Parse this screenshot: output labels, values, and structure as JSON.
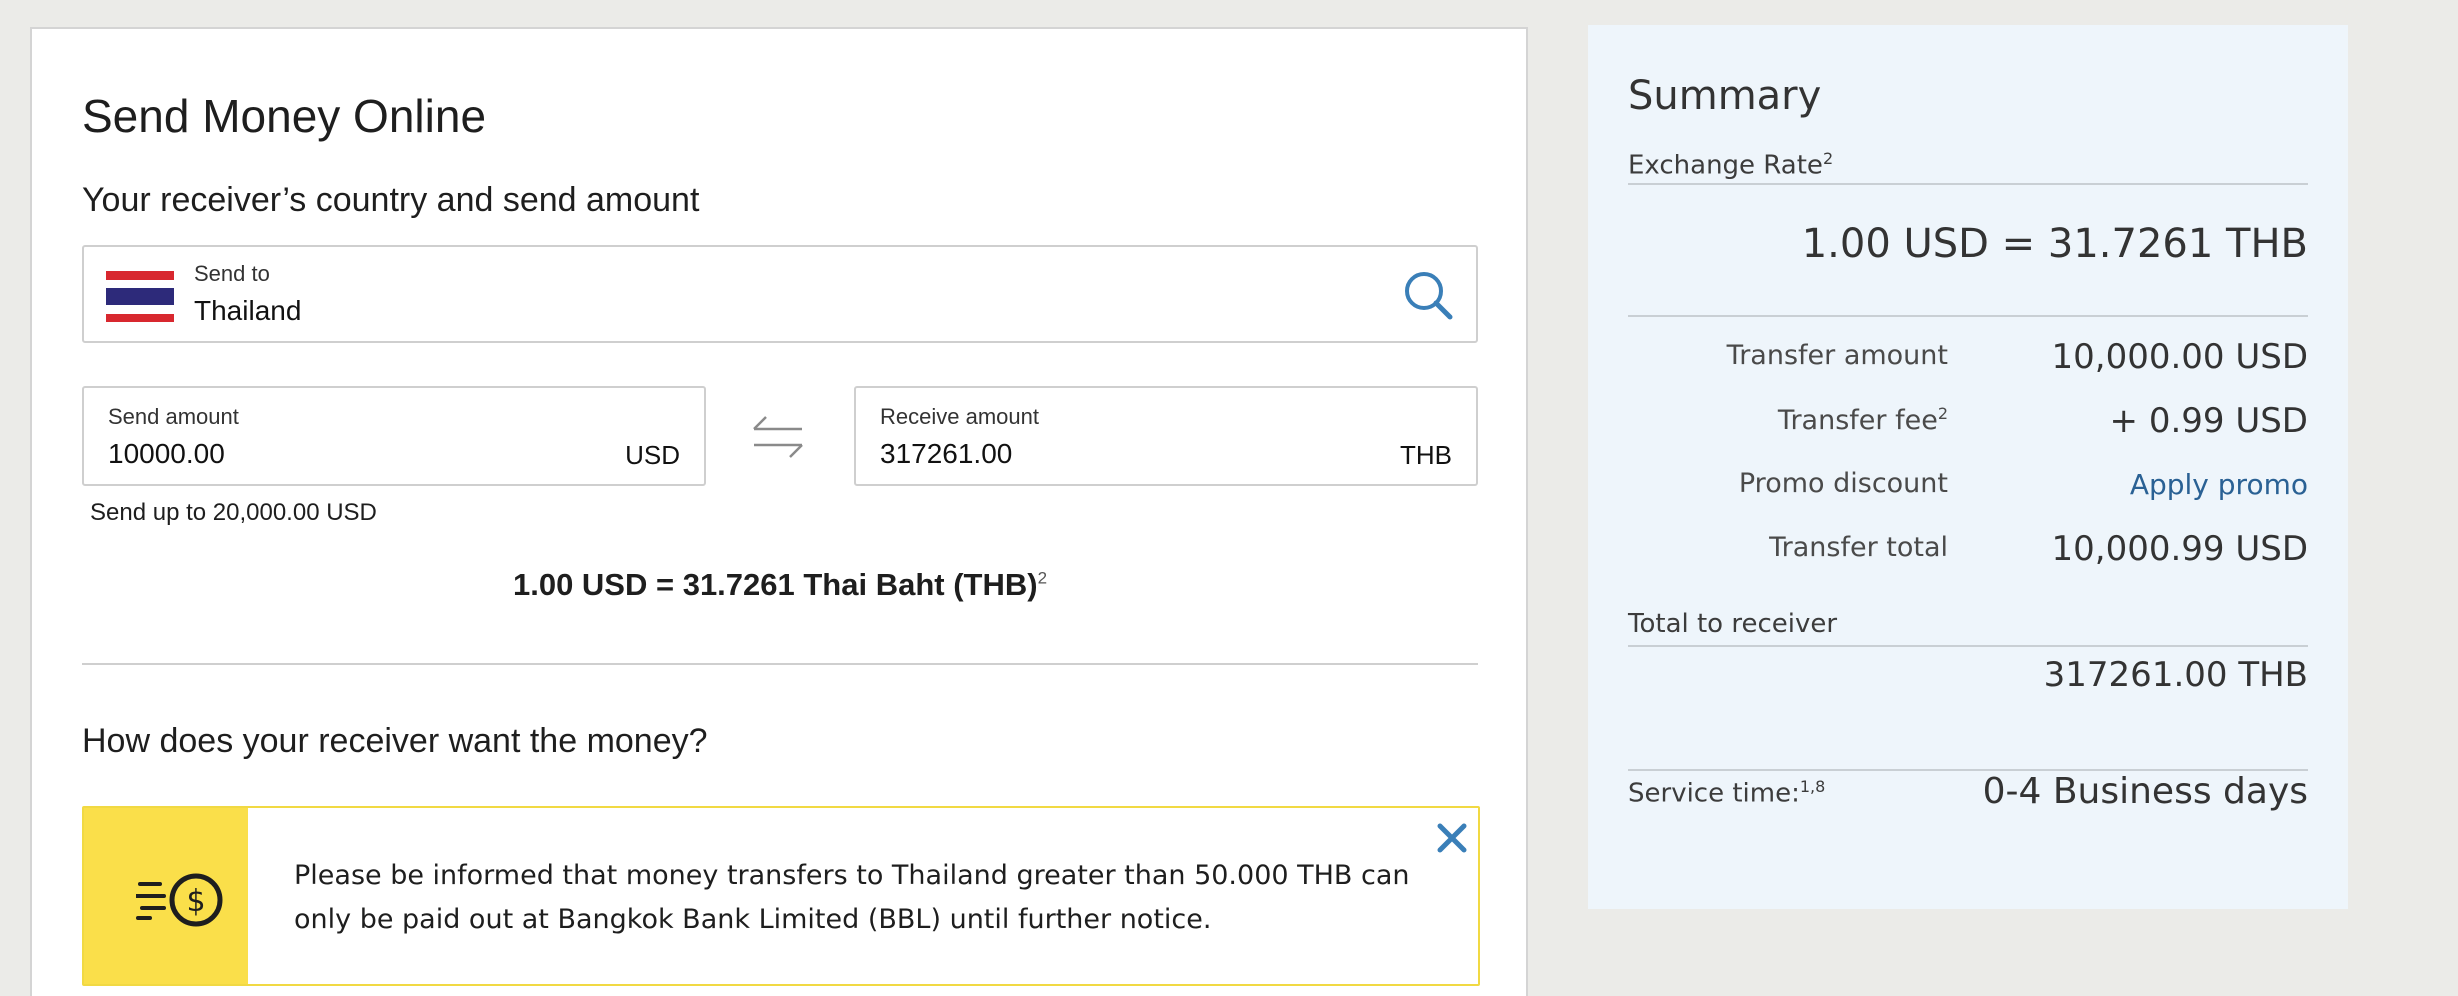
{
  "page": {
    "title": "Send Money Online",
    "country_section_title": "Your receiver’s country and send amount",
    "payout_section_title": "How does your receiver want the money?"
  },
  "country": {
    "label": "Send to",
    "value": "Thailand"
  },
  "send_amount": {
    "label": "Send amount",
    "value": "10000.00",
    "currency": "USD",
    "limit_text": "Send up to 20,000.00 USD"
  },
  "receive_amount": {
    "label": "Receive amount",
    "value": "317261.00",
    "currency": "THB"
  },
  "rate": {
    "text": "1.00 USD = 31.7261 Thai Baht (THB)",
    "footnote": "2"
  },
  "notice": {
    "text": "Please be informed that money transfers to Thailand greater than 50.000 THB can only be paid out at Bangkok Bank Limited (BBL) until further notice."
  },
  "summary": {
    "title": "Summary",
    "exchange_rate_label": "Exchange Rate",
    "exchange_rate_footnote": "2",
    "exchange_rate_value": "1.00 USD = 31.7261 THB",
    "rows": [
      {
        "label": "Transfer amount",
        "footnote": "",
        "value": "10,000.00 USD"
      },
      {
        "label": "Transfer fee",
        "footnote": "2",
        "value": "+ 0.99 USD"
      },
      {
        "label": "Promo discount",
        "footnote": "",
        "value": "Apply promo"
      },
      {
        "label": "Transfer total",
        "footnote": "",
        "value": "10,000.99 USD"
      }
    ],
    "total_receiver_label": "Total  to receiver",
    "total_receiver_value": "317261.00 THB",
    "service_time_label": "Service time:",
    "service_time_footnote": "1,8",
    "service_time_value": "0-4 Business days"
  },
  "colors": {
    "accent_blue": "#3a7fb8",
    "link_blue": "#2a6194",
    "notice_yellow": "#fadf4a",
    "flag_red": "#d8282f",
    "flag_blue": "#2d2a7a"
  },
  "icons": {
    "search": "search-icon",
    "swap": "swap-arrows-icon",
    "money_fast": "fast-money-icon",
    "close": "close-icon",
    "flag": "thailand-flag-icon"
  }
}
